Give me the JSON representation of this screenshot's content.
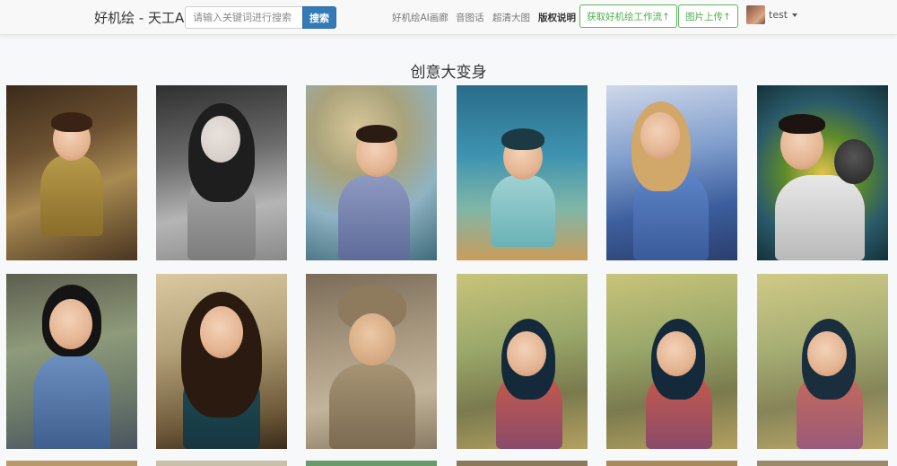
{
  "nav": {
    "brand": "好机绘 - 天工AI",
    "search_placeholder": "请输入关键词进行搜索",
    "search_button": "搜索",
    "links": [
      "好机绘AI画廊",
      "音图话",
      "超清大图"
    ],
    "copyright": "版权说明",
    "workflow_button": "获取好机绘工作流↑",
    "upload_button": "图片上传↑",
    "user": "test"
  },
  "section": {
    "title": "创意大变身"
  },
  "gallery": {
    "items": [
      {
        "theme": "baroque-painting-child-at-desk"
      },
      {
        "theme": "ink-wash-girl-gray"
      },
      {
        "theme": "angel-child-with-clocks"
      },
      {
        "theme": "underwater-child-with-fish"
      },
      {
        "theme": "princess-blue-dress-castle"
      },
      {
        "theme": "boy-hugging-puppies"
      },
      {
        "theme": "girl-blue-dress-garden"
      },
      {
        "theme": "woman-golden-headdress"
      },
      {
        "theme": "child-stone-relief-sculpture"
      },
      {
        "theme": "girl-hanfu-chinese-courtyard"
      },
      {
        "theme": "girl-hanfu-chinese-courtyard"
      },
      {
        "theme": "girl-hanfu-chinese-courtyard"
      }
    ]
  }
}
